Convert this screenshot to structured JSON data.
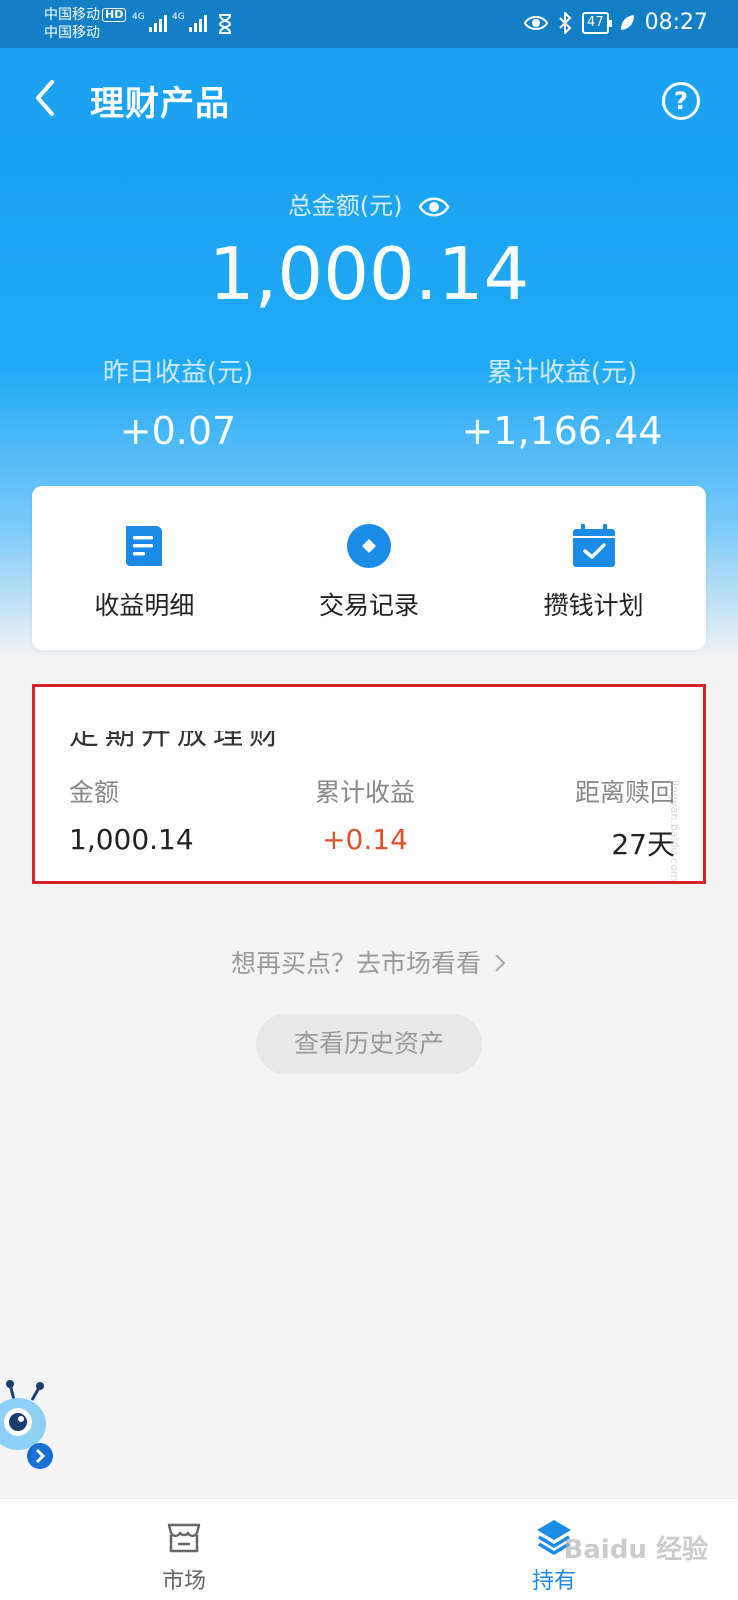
{
  "status_bar": {
    "carrier_1": "中国移动",
    "carrier_hd": "HD",
    "carrier_2": "中国移动",
    "network_1": "4G",
    "network_2": "4G",
    "battery": "47",
    "time": "08:27"
  },
  "header": {
    "title": "理财产品",
    "help_icon": "question-circle-icon"
  },
  "summary": {
    "total_label": "总金额(元)",
    "total_amount": "1,000.14",
    "yesterday_label": "昨日收益(元)",
    "yesterday_value": "+0.07",
    "cumulative_label": "累计收益(元)",
    "cumulative_value": "+1,166.44"
  },
  "actions": [
    {
      "label": "收益明细",
      "icon": "document-icon"
    },
    {
      "label": "交易记录",
      "icon": "record-circle-icon"
    },
    {
      "label": "攒钱计划",
      "icon": "calendar-check-icon"
    }
  ],
  "holding_card": {
    "title_partial": "定期开放理财",
    "amount_label": "金额",
    "amount_value": "1,000.14",
    "profit_label": "累计收益",
    "profit_value": "+0.14",
    "redeem_label": "距离赎回",
    "redeem_value": "27天",
    "highlight_color": "#d4232a",
    "profit_color": "#e1502a"
  },
  "links": {
    "market_link": "想再买点？去市场看看",
    "history_button": "查看历史资产"
  },
  "tabbar": {
    "market_label": "市场",
    "hold_label": "持有",
    "active": "持有"
  },
  "watermark": {
    "brand": "Baidu 经验",
    "url": "jingyan.baidu.com"
  },
  "colors": {
    "primary_blue": "#1aa0f2",
    "status_bar": "#127fc6",
    "active_tab": "#1a8be6"
  }
}
